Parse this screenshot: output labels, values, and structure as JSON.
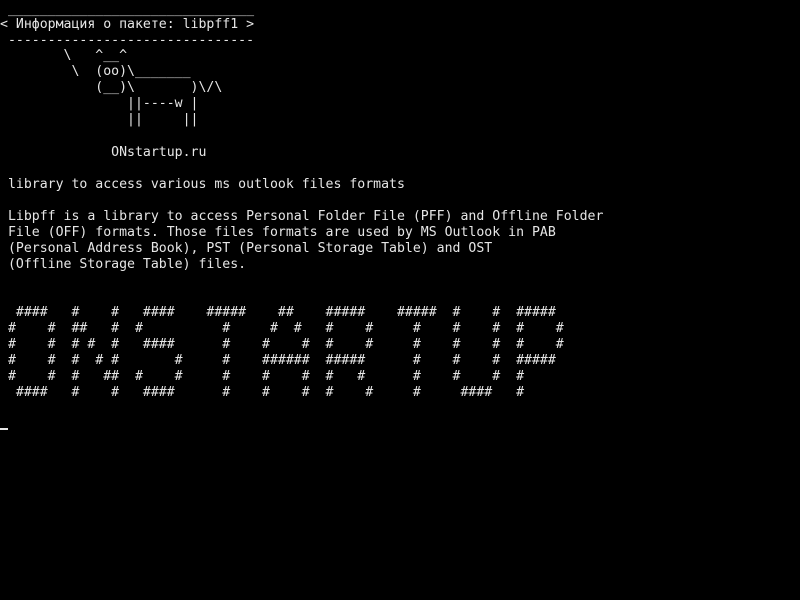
{
  "terminal": {
    "header_border_top": " _______________________________",
    "header_title": "< Информация о пакете: libpff1 >",
    "header_border_bottom": " -------------------------------",
    "cow": [
      "        \\   ^__^",
      "         \\  (oo)\\_______",
      "            (__)\\       )\\/\\",
      "                ||----w |",
      "                ||     ||"
    ],
    "site": "              ONstartup.ru",
    "summary": " library to access various ms outlook files formats",
    "description": [
      " Libpff is a library to access Personal Folder File (PFF) and Offline Folder",
      " File (OFF) formats. Those files formats are used by MS Outlook in PAB",
      " (Personal Address Book), PST (Personal Storage Table) and OST",
      " (Offline Storage Table) files."
    ],
    "banner": [
      "  ####   #    #   ####    #####    ##    #####    #####  #    #  #####",
      " #    #  ##   #  #          #     #  #   #    #     #    #    #  #    #",
      " #    #  # #  #   ####      #    #    #  #    #     #    #    #  #    #",
      " #    #  #  # #       #     #    ######  #####      #    #    #  #####",
      " #    #  #   ##  #    #     #    #    #  #   #      #    #    #  #",
      "  ####   #    #   ####      #    #    #  #    #     #     ####   #"
    ]
  }
}
